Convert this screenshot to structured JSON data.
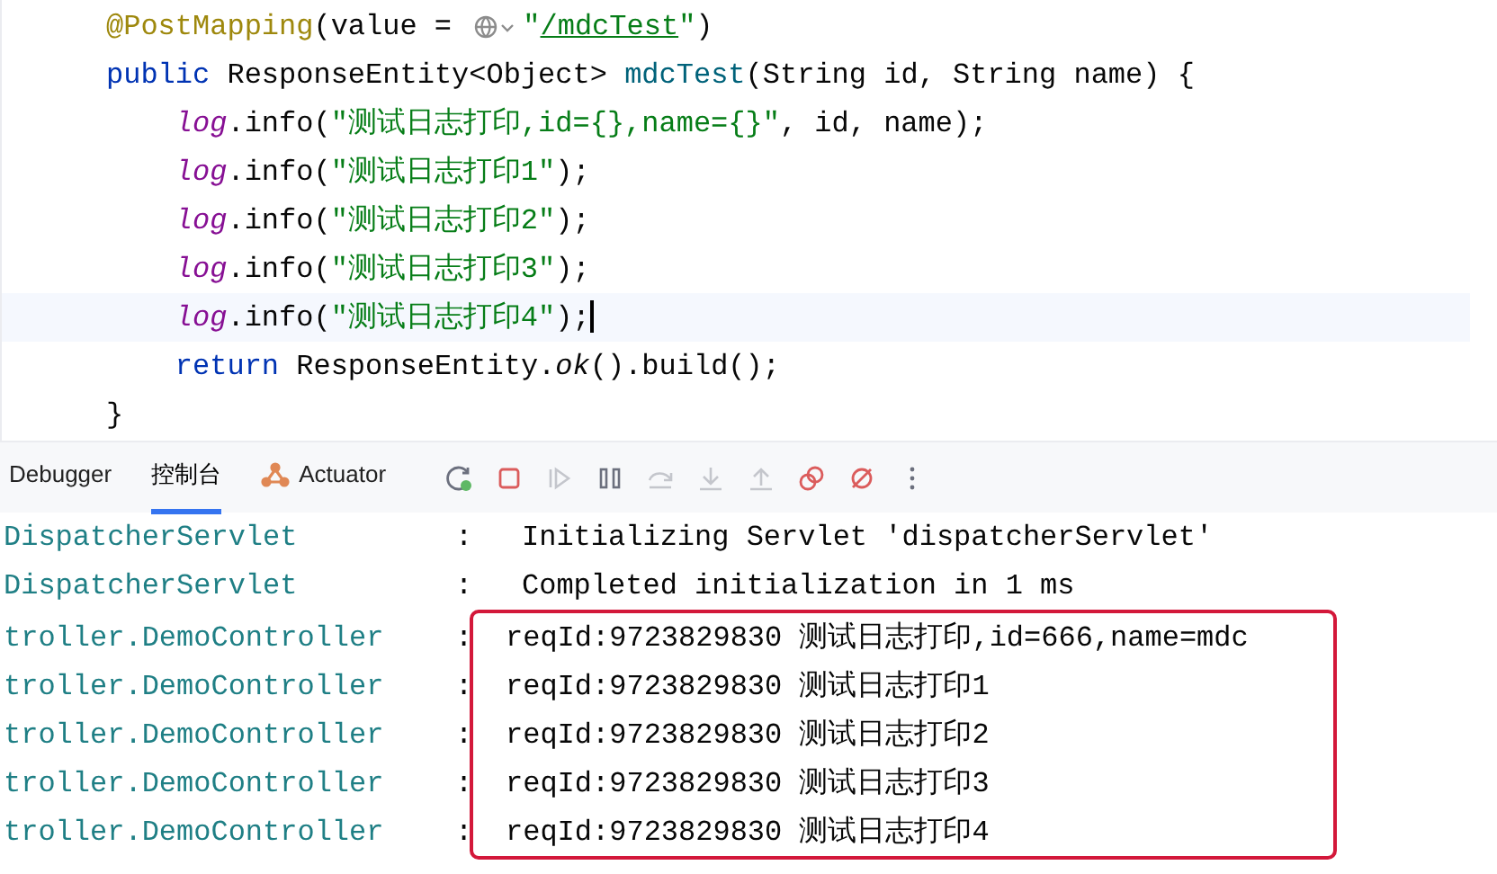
{
  "editor": {
    "lines": [
      {
        "current": false,
        "tokens": [
          {
            "kind": "annotation",
            "text": "@PostMapping"
          },
          {
            "kind": "plain",
            "text": "(value = "
          },
          {
            "kind": "icon"
          },
          {
            "kind": "string",
            "text": "\""
          },
          {
            "kind": "link",
            "text": "/mdcTest"
          },
          {
            "kind": "string",
            "text": "\""
          },
          {
            "kind": "plain",
            "text": ")"
          }
        ]
      },
      {
        "current": false,
        "tokens": [
          {
            "kind": "keyword",
            "text": "public "
          },
          {
            "kind": "plain",
            "text": "ResponseEntity<Object> "
          },
          {
            "kind": "method",
            "text": "mdcTest"
          },
          {
            "kind": "plain",
            "text": "(String id, String name) {"
          }
        ]
      },
      {
        "current": false,
        "tokens": [
          {
            "kind": "field",
            "text": "    log"
          },
          {
            "kind": "plain",
            "text": ".info("
          },
          {
            "kind": "string",
            "text": "\"测试日志打印,id={},name={}\""
          },
          {
            "kind": "plain",
            "text": ", id, name);"
          }
        ]
      },
      {
        "current": false,
        "tokens": [
          {
            "kind": "field",
            "text": "    log"
          },
          {
            "kind": "plain",
            "text": ".info("
          },
          {
            "kind": "string",
            "text": "\"测试日志打印1\""
          },
          {
            "kind": "plain",
            "text": ");"
          }
        ]
      },
      {
        "current": false,
        "tokens": [
          {
            "kind": "field",
            "text": "    log"
          },
          {
            "kind": "plain",
            "text": ".info("
          },
          {
            "kind": "string",
            "text": "\"测试日志打印2\""
          },
          {
            "kind": "plain",
            "text": ");"
          }
        ]
      },
      {
        "current": false,
        "tokens": [
          {
            "kind": "field",
            "text": "    log"
          },
          {
            "kind": "plain",
            "text": ".info("
          },
          {
            "kind": "string",
            "text": "\"测试日志打印3\""
          },
          {
            "kind": "plain",
            "text": ");"
          }
        ]
      },
      {
        "current": true,
        "tokens": [
          {
            "kind": "field",
            "text": "    log"
          },
          {
            "kind": "plain",
            "text": ".info("
          },
          {
            "kind": "string",
            "text": "\"测试日志打印4\""
          },
          {
            "kind": "plain",
            "text": ");"
          }
        ]
      },
      {
        "current": false,
        "tokens": [
          {
            "kind": "keyword",
            "text": "    return "
          },
          {
            "kind": "plain",
            "text": "ResponseEntity."
          },
          {
            "kind": "static",
            "text": "ok"
          },
          {
            "kind": "plain",
            "text": "().build();"
          }
        ]
      },
      {
        "current": false,
        "tokens": [
          {
            "kind": "plain",
            "text": "}"
          }
        ]
      }
    ]
  },
  "toolbar": {
    "tabs": [
      {
        "label": "Debugger",
        "selected": false,
        "kind": "plain"
      },
      {
        "label": "控制台",
        "selected": true,
        "kind": "plain"
      },
      {
        "label": "Actuator",
        "selected": false,
        "kind": "actuator"
      }
    ],
    "buttons": [
      {
        "kind": "rerun",
        "disabled": false
      },
      {
        "kind": "stop",
        "disabled": false
      },
      {
        "kind": "resume",
        "disabled": true
      },
      {
        "kind": "pause",
        "disabled": false
      },
      {
        "kind": "step-over",
        "disabled": true
      },
      {
        "kind": "step-into",
        "disabled": true
      },
      {
        "kind": "step-out",
        "disabled": true
      },
      {
        "kind": "breakpoints",
        "disabled": false
      },
      {
        "kind": "mute",
        "disabled": false
      },
      {
        "kind": "more",
        "disabled": false
      }
    ]
  },
  "console": {
    "rows": [
      {
        "logger": "DispatcherServlet",
        "separator": ":",
        "message": "Initializing Servlet 'dispatcherServlet'"
      },
      {
        "logger": "DispatcherServlet",
        "separator": ":",
        "message": "Completed initialization in 1 ms"
      }
    ],
    "highlighted_rows": [
      {
        "logger": "troller.DemoController",
        "separator": ":",
        "message": "reqId:9723829830 测试日志打印,id=666,name=mdc"
      },
      {
        "logger": "troller.DemoController",
        "separator": ":",
        "message": "reqId:9723829830 测试日志打印1"
      },
      {
        "logger": "troller.DemoController",
        "separator": ":",
        "message": "reqId:9723829830 测试日志打印2"
      },
      {
        "logger": "troller.DemoController",
        "separator": ":",
        "message": "reqId:9723829830 测试日志打印3"
      },
      {
        "logger": "troller.DemoController",
        "separator": ":",
        "message": "reqId:9723829830 测试日志打印4"
      }
    ]
  }
}
